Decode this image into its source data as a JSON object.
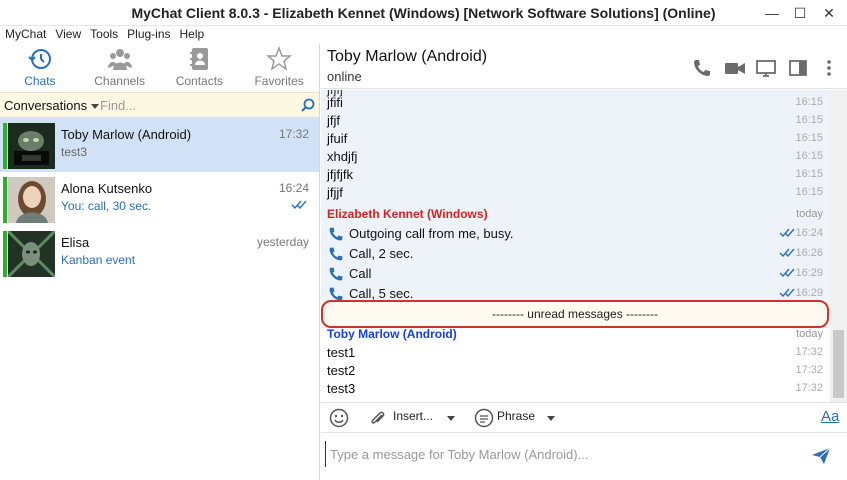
{
  "window": {
    "title": "MyChat Client 8.0.3 - Elizabeth Kennet (Windows) [Network Software Solutions] (Online)",
    "minimize": "—",
    "maximize": "☐",
    "close": "✕"
  },
  "menu": [
    "MyChat",
    "View",
    "Tools",
    "Plug-ins",
    "Help"
  ],
  "nav": {
    "tabs": [
      {
        "label": "Chats",
        "icon": "history-icon",
        "active": true
      },
      {
        "label": "Channels",
        "icon": "group-icon",
        "active": false
      },
      {
        "label": "Contacts",
        "icon": "contacts-book-icon",
        "active": false
      },
      {
        "label": "Favorites",
        "icon": "star-icon",
        "active": false
      }
    ]
  },
  "search": {
    "dropdown_label": "Conversations",
    "placeholder": "Find..."
  },
  "conversations": [
    {
      "name": "Toby Marlow (Android)",
      "last": "test3",
      "time": "17:32",
      "selected": true,
      "online_color": "#2fae32"
    },
    {
      "name": "Alona Kutsenko",
      "last": "You: call, 30 sec.",
      "time": "16:24",
      "selected": false,
      "online_color": "#2fae32"
    },
    {
      "name": "Elisa",
      "last": "Kanban event",
      "time": "yesterday",
      "selected": false,
      "online_color": "#2fae32"
    }
  ],
  "chat": {
    "contact_name": "Toby Marlow (Android)",
    "status": "online",
    "partial_top": "jfjfj",
    "messages_a": [
      {
        "text": "jfifi",
        "time": "16:15"
      },
      {
        "text": "jfjf",
        "time": "16:15"
      },
      {
        "text": "jfuif",
        "time": "16:15"
      },
      {
        "text": "xhdjfj",
        "time": "16:15"
      },
      {
        "text": "jfjfjfk",
        "time": "16:15"
      },
      {
        "text": "jfjjf",
        "time": "16:15"
      }
    ],
    "sender_me": {
      "name": "Elizabeth Kennet (Windows)",
      "day": "today",
      "color": "#d42222"
    },
    "messages_me": [
      {
        "text": "Outgoing call from me, busy.",
        "time": "16:24"
      },
      {
        "text": "Call, 2 sec.",
        "time": "16:26"
      },
      {
        "text": "Call",
        "time": "16:29"
      },
      {
        "text": "Call, 5 sec.",
        "time": "16:29"
      }
    ],
    "unread_label": "-------- unread messages --------",
    "sender_other": {
      "name": "Toby Marlow (Android)",
      "day": "today",
      "color": "#1a3fd6"
    },
    "messages_other": [
      {
        "text": "test1",
        "time": "17:32"
      },
      {
        "text": "test2",
        "time": "17:32"
      },
      {
        "text": "test3",
        "time": "17:32"
      }
    ]
  },
  "toolbar": {
    "insert_label": "Insert...",
    "phrase_label": "Phrase",
    "font_label": "Aa"
  },
  "composer": {
    "placeholder": "Type a message for Toby Marlow (Android)..."
  },
  "colors": {
    "accent": "#2b6fb6",
    "selected_row": "#d2e2f6",
    "unread_border": "#d0322e"
  }
}
